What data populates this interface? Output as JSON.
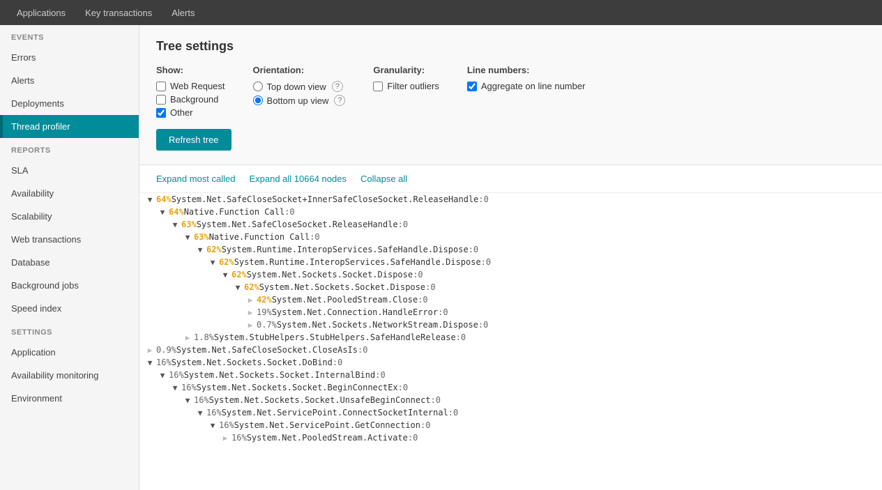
{
  "topnav": {
    "items": [
      "Applications",
      "Key transactions",
      "Alerts"
    ]
  },
  "sidebar": {
    "events_label": "EVENTS",
    "events_items": [
      {
        "label": "Errors",
        "active": false
      },
      {
        "label": "Alerts",
        "active": false
      },
      {
        "label": "Deployments",
        "active": false
      },
      {
        "label": "Thread profiler",
        "active": true
      }
    ],
    "reports_label": "REPORTS",
    "reports_items": [
      {
        "label": "SLA",
        "active": false
      },
      {
        "label": "Availability",
        "active": false
      },
      {
        "label": "Scalability",
        "active": false
      },
      {
        "label": "Web transactions",
        "active": false
      },
      {
        "label": "Database",
        "active": false
      },
      {
        "label": "Background jobs",
        "active": false
      },
      {
        "label": "Speed index",
        "active": false
      }
    ],
    "settings_label": "SETTINGS",
    "settings_items": [
      {
        "label": "Application",
        "active": false
      },
      {
        "label": "Availability monitoring",
        "active": false
      },
      {
        "label": "Environment",
        "active": false
      }
    ]
  },
  "tree_settings": {
    "title": "Tree settings",
    "show_label": "Show:",
    "show_items": [
      {
        "label": "Web Request",
        "checked": false
      },
      {
        "label": "Background",
        "checked": false
      },
      {
        "label": "Other",
        "checked": true
      }
    ],
    "orientation_label": "Orientation:",
    "orientation_items": [
      {
        "label": "Top down view",
        "checked": false,
        "has_help": true
      },
      {
        "label": "Bottom up view",
        "checked": true,
        "has_help": true
      }
    ],
    "granularity_label": "Granularity:",
    "granularity_items": [
      {
        "label": "Filter outliers",
        "checked": false
      }
    ],
    "line_numbers_label": "Line numbers:",
    "line_numbers_items": [
      {
        "label": "Aggregate on line number",
        "checked": true
      }
    ],
    "refresh_label": "Refresh tree"
  },
  "tree_toolbar": {
    "expand_most": "Expand most called",
    "expand_all": "Expand all 10664 nodes",
    "collapse_all": "Collapse all"
  },
  "tree_nodes": [
    {
      "indent": 0,
      "toggle": "expanded",
      "pct": "64%",
      "pct_class": "pct-orange",
      "text": "System.Net.SafeCloseSocket+InnerSafeCloseSocket.ReleaseHandle",
      "num": ":0"
    },
    {
      "indent": 1,
      "toggle": "expanded",
      "pct": "64%",
      "pct_class": "pct-orange",
      "text": "Native.Function Call",
      "num": ":0"
    },
    {
      "indent": 2,
      "toggle": "expanded",
      "pct": "63%",
      "pct_class": "pct-orange",
      "text": "System.Net.SafeCloseSocket.ReleaseHandle",
      "num": ":0"
    },
    {
      "indent": 3,
      "toggle": "expanded",
      "pct": "63%",
      "pct_class": "pct-orange",
      "text": "Native.Function Call",
      "num": ":0"
    },
    {
      "indent": 4,
      "toggle": "expanded",
      "pct": "62%",
      "pct_class": "pct-orange",
      "text": "System.Runtime.InteropServices.SafeHandle.Dispose",
      "num": ":0"
    },
    {
      "indent": 5,
      "toggle": "expanded",
      "pct": "62%",
      "pct_class": "pct-orange",
      "text": "System.Runtime.InteropServices.SafeHandle.Dispose",
      "num": ":0"
    },
    {
      "indent": 6,
      "toggle": "expanded",
      "pct": "62%",
      "pct_class": "pct-orange",
      "text": "System.Net.Sockets.Socket.Dispose",
      "num": ":0"
    },
    {
      "indent": 7,
      "toggle": "expanded",
      "pct": "62%",
      "pct_class": "pct-orange",
      "text": "System.Net.Sockets.Socket.Dispose",
      "num": ":0"
    },
    {
      "indent": 8,
      "toggle": "leaf",
      "pct": "42%",
      "pct_class": "pct-orange",
      "text": "System.Net.PooledStream.Close",
      "num": ":0"
    },
    {
      "indent": 8,
      "toggle": "leaf",
      "pct": "19%",
      "pct_class": "pct-gray",
      "text": "System.Net.Connection.HandleError",
      "num": ":0"
    },
    {
      "indent": 8,
      "toggle": "leaf",
      "pct": "0.7%",
      "pct_class": "pct-gray",
      "text": "System.Net.Sockets.NetworkStream.Dispose",
      "num": ":0"
    },
    {
      "indent": 3,
      "toggle": "leaf",
      "pct": "1.8%",
      "pct_class": "pct-gray",
      "text": "System.StubHelpers.StubHelpers.SafeHandleRelease",
      "num": ":0"
    },
    {
      "indent": 0,
      "toggle": "leaf",
      "pct": "0.9%",
      "pct_class": "pct-gray",
      "text": "System.Net.SafeCloseSocket.CloseAsIs",
      "num": ":0"
    },
    {
      "indent": 0,
      "toggle": "expanded",
      "pct": "16%",
      "pct_class": "pct-gray",
      "text": "System.Net.Sockets.Socket.DoBind",
      "num": ":0"
    },
    {
      "indent": 1,
      "toggle": "expanded",
      "pct": "16%",
      "pct_class": "pct-gray",
      "text": "System.Net.Sockets.Socket.InternalBind",
      "num": ":0"
    },
    {
      "indent": 2,
      "toggle": "expanded",
      "pct": "16%",
      "pct_class": "pct-gray",
      "text": "System.Net.Sockets.Socket.BeginConnectEx",
      "num": ":0"
    },
    {
      "indent": 3,
      "toggle": "expanded",
      "pct": "16%",
      "pct_class": "pct-gray",
      "text": "System.Net.Sockets.Socket.UnsafeBeginConnect",
      "num": ":0"
    },
    {
      "indent": 4,
      "toggle": "expanded",
      "pct": "16%",
      "pct_class": "pct-gray",
      "text": "System.Net.ServicePoint.ConnectSocketInternal",
      "num": ":0"
    },
    {
      "indent": 5,
      "toggle": "expanded",
      "pct": "16%",
      "pct_class": "pct-gray",
      "text": "System.Net.ServicePoint.GetConnection",
      "num": ":0"
    },
    {
      "indent": 6,
      "toggle": "leaf",
      "pct": "16%",
      "pct_class": "pct-gray",
      "text": "System.Net.PooledStream.Activate",
      "num": ":0"
    }
  ]
}
